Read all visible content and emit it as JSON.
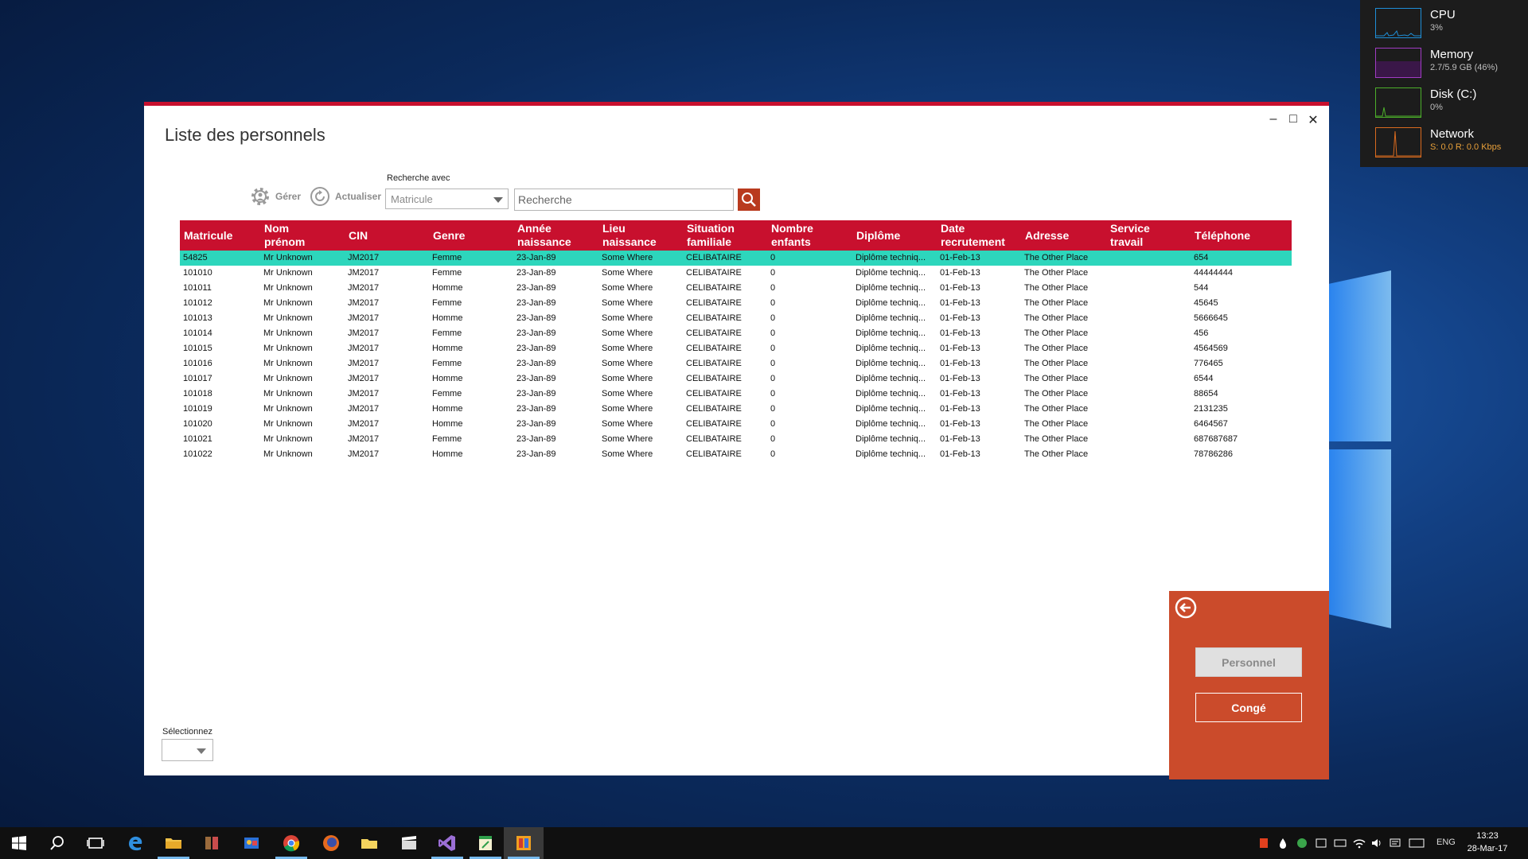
{
  "perf": {
    "cpu": {
      "name": "CPU",
      "value": "3%",
      "color": "#1e8fd8"
    },
    "memory": {
      "name": "Memory",
      "value": "2.7/5.9 GB (46%)",
      "color": "#a13cc4"
    },
    "disk": {
      "name": "Disk (C:)",
      "value": "0%",
      "color": "#4caf2a"
    },
    "network": {
      "name": "Network",
      "value_s": "S: 0.0",
      "value_r": "R: 0.0 Kbps",
      "color": "#d96a1e"
    }
  },
  "window": {
    "title": "Liste des personnels"
  },
  "toolbar": {
    "manage_label": "Gérer",
    "refresh_label": "Actualiser"
  },
  "search": {
    "with_label": "Recherche avec",
    "field_selected": "Matricule",
    "placeholder": "Recherche"
  },
  "table": {
    "columns": [
      [
        "Matricule"
      ],
      [
        "Nom",
        "prénom"
      ],
      [
        "CIN"
      ],
      [
        "Genre"
      ],
      [
        "Année",
        "naissance"
      ],
      [
        "Lieu",
        "naissance"
      ],
      [
        "Situation",
        "familiale"
      ],
      [
        "Nombre",
        "enfants"
      ],
      [
        "Diplôme"
      ],
      [
        "Date",
        "recrutement"
      ],
      [
        "Adresse"
      ],
      [
        "Service",
        "travail"
      ],
      [
        "Téléphone"
      ]
    ],
    "rows": [
      [
        "54825",
        "Mr Unknown",
        "JM2017",
        "Femme",
        "23-Jan-89",
        "Some Where",
        "CELIBATAIRE",
        "0",
        "Diplôme techniq...",
        "01-Feb-13",
        "The Other Place",
        "",
        "654"
      ],
      [
        "101010",
        "Mr Unknown",
        "JM2017",
        "Femme",
        "23-Jan-89",
        "Some Where",
        "CELIBATAIRE",
        "0",
        "Diplôme techniq...",
        "01-Feb-13",
        "The Other Place",
        "",
        "44444444"
      ],
      [
        "101011",
        "Mr Unknown",
        "JM2017",
        "Homme",
        "23-Jan-89",
        "Some Where",
        "CELIBATAIRE",
        "0",
        "Diplôme techniq...",
        "01-Feb-13",
        "The Other Place",
        "",
        "544"
      ],
      [
        "101012",
        "Mr Unknown",
        "JM2017",
        "Femme",
        "23-Jan-89",
        "Some Where",
        "CELIBATAIRE",
        "0",
        "Diplôme techniq...",
        "01-Feb-13",
        "The Other Place",
        "",
        "45645"
      ],
      [
        "101013",
        "Mr Unknown",
        "JM2017",
        "Homme",
        "23-Jan-89",
        "Some Where",
        "CELIBATAIRE",
        "0",
        "Diplôme techniq...",
        "01-Feb-13",
        "The Other Place",
        "",
        "5666645"
      ],
      [
        "101014",
        "Mr Unknown",
        "JM2017",
        "Femme",
        "23-Jan-89",
        "Some Where",
        "CELIBATAIRE",
        "0",
        "Diplôme techniq...",
        "01-Feb-13",
        "The Other Place",
        "",
        "456"
      ],
      [
        "101015",
        "Mr Unknown",
        "JM2017",
        "Homme",
        "23-Jan-89",
        "Some Where",
        "CELIBATAIRE",
        "0",
        "Diplôme techniq...",
        "01-Feb-13",
        "The Other Place",
        "",
        "4564569"
      ],
      [
        "101016",
        "Mr Unknown",
        "JM2017",
        "Femme",
        "23-Jan-89",
        "Some Where",
        "CELIBATAIRE",
        "0",
        "Diplôme techniq...",
        "01-Feb-13",
        "The Other Place",
        "",
        "776465"
      ],
      [
        "101017",
        "Mr Unknown",
        "JM2017",
        "Homme",
        "23-Jan-89",
        "Some Where",
        "CELIBATAIRE",
        "0",
        "Diplôme techniq...",
        "01-Feb-13",
        "The Other Place",
        "",
        "6544"
      ],
      [
        "101018",
        "Mr Unknown",
        "JM2017",
        "Femme",
        "23-Jan-89",
        "Some Where",
        "CELIBATAIRE",
        "0",
        "Diplôme techniq...",
        "01-Feb-13",
        "The Other Place",
        "",
        "88654"
      ],
      [
        "101019",
        "Mr Unknown",
        "JM2017",
        "Homme",
        "23-Jan-89",
        "Some Where",
        "CELIBATAIRE",
        "0",
        "Diplôme techniq...",
        "01-Feb-13",
        "The Other Place",
        "",
        "2131235"
      ],
      [
        "101020",
        "Mr Unknown",
        "JM2017",
        "Homme",
        "23-Jan-89",
        "Some Where",
        "CELIBATAIRE",
        "0",
        "Diplôme techniq...",
        "01-Feb-13",
        "The Other Place",
        "",
        "6464567"
      ],
      [
        "101021",
        "Mr Unknown",
        "JM2017",
        "Femme",
        "23-Jan-89",
        "Some Where",
        "CELIBATAIRE",
        "0",
        "Diplôme techniq...",
        "01-Feb-13",
        "The Other Place",
        "",
        "687687687"
      ],
      [
        "101022",
        "Mr Unknown",
        "JM2017",
        "Homme",
        "23-Jan-89",
        "Some Where",
        "CELIBATAIRE",
        "0",
        "Diplôme techniq...",
        "01-Feb-13",
        "The Other Place",
        "",
        "78786286"
      ]
    ],
    "selected_row": 0
  },
  "bottom_select": {
    "label": "Sélectionnez"
  },
  "side_panel": {
    "personnel_label": "Personnel",
    "conge_label": "Congé"
  },
  "taskbar": {
    "language": "ENG",
    "time": "13:23",
    "date": "28-Mar-17"
  },
  "colors": {
    "accent": "#c8102e",
    "selected_row": "#2dd6bc",
    "side_panel": "#cb4b2b"
  }
}
